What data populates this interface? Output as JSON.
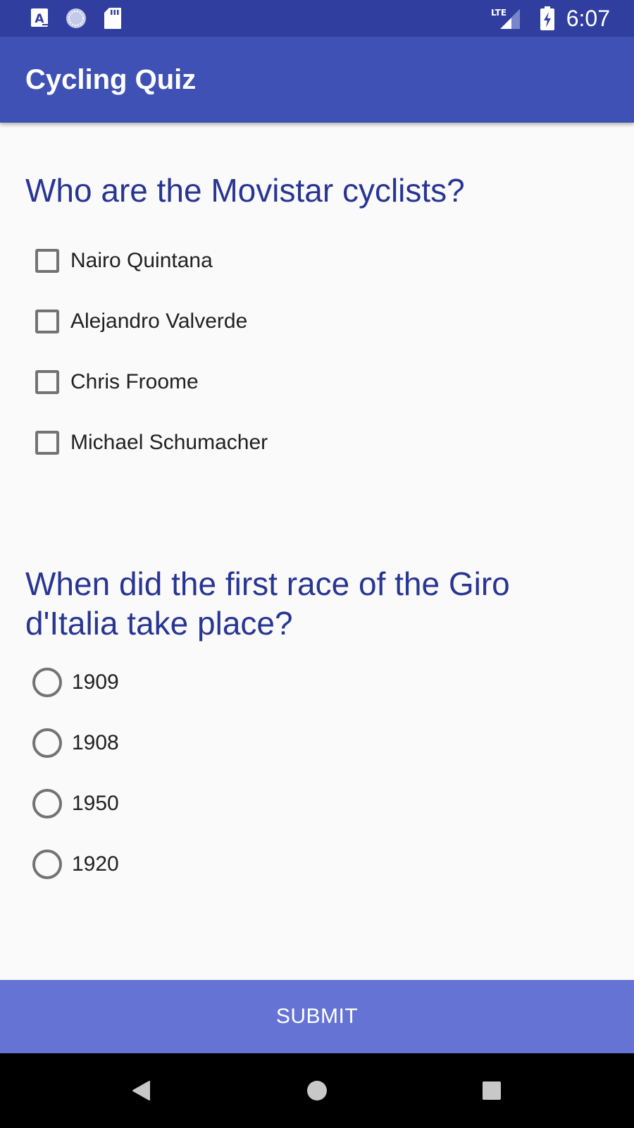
{
  "status_bar": {
    "time": "6:07",
    "icons": [
      "a-notification-icon",
      "sync-icon",
      "sd-card-icon",
      "lte-signal-icon",
      "battery-charging-icon"
    ],
    "network_label": "LTE"
  },
  "app_bar": {
    "title": "Cycling Quiz"
  },
  "questions": [
    {
      "text": "Who are the Movistar cyclists?",
      "type": "checkbox",
      "options": [
        "Nairo Quintana",
        "Alejandro Valverde",
        "Chris Froome",
        "Michael Schumacher"
      ]
    },
    {
      "text": "When did the first race of the Giro d'Italia take place?",
      "type": "radio",
      "options": [
        "1909",
        "1908",
        "1950",
        "1920"
      ]
    }
  ],
  "submit": {
    "label": "SUBMIT"
  },
  "nav_bar": {
    "icons": [
      "back-icon",
      "home-icon",
      "recents-icon"
    ]
  },
  "colors": {
    "status_bar": "#303f9f",
    "app_bar": "#3f51b5",
    "question_text": "#283593",
    "submit_button": "#6574d4",
    "control_outline": "#737373"
  }
}
